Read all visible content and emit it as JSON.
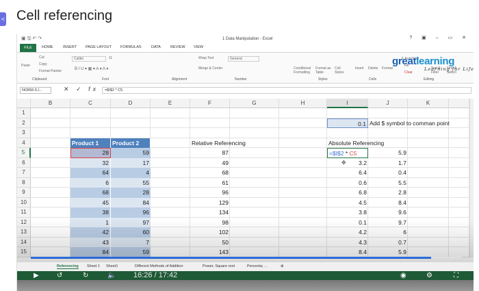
{
  "page": {
    "title": "Cell referencing",
    "side_tab": "<"
  },
  "excel": {
    "window_title": "1 Data Manipulation - Excel",
    "window_buttons": "? ▣ – ▭ ✕",
    "file_tab": "FILE",
    "tabs": [
      "HOME",
      "INSERT",
      "PAGE LAYOUT",
      "FORMULAS",
      "DATA",
      "REVIEW",
      "VIEW"
    ],
    "ribbon": {
      "clipboard": {
        "paste": "Paste",
        "cut": "Cut",
        "copy": "Copy",
        "format_painter": "Format Painter",
        "label": "Clipboard"
      },
      "font": {
        "name": "Calibri",
        "size": "11",
        "label": "Font"
      },
      "alignment": {
        "wrap": "Wrap Text",
        "merge": "Merge & Center",
        "label": "Alignment"
      },
      "number": {
        "format": "General",
        "label": "Number"
      },
      "styles": {
        "conditional": "Conditional Formatting",
        "format_table": "Format as Table",
        "cell_styles": "Cell Styles",
        "label": "Styles"
      },
      "cells": {
        "insert": "Insert",
        "delete": "Delete",
        "format": "Format",
        "label": "Cells"
      },
      "editing": {
        "autosum": "AutoSum",
        "fill": "Fill",
        "clear": "Clear",
        "sort": "Sort & Filter",
        "find": "Find & Select",
        "label": "Editing"
      }
    },
    "logo": {
      "part1": "great",
      "part2": "learning",
      "tagline": "Learning for Life"
    },
    "name_box": "NORM.S.I...",
    "formula": "=$I$2 * C5",
    "columns": [
      "B",
      "C",
      "D",
      "E",
      "F",
      "G",
      "H",
      "I",
      "J",
      "K"
    ],
    "rows": [
      "1",
      "2",
      "3",
      "4",
      "5",
      "6",
      "7",
      "8",
      "9",
      "10",
      "11",
      "12",
      "13",
      "14",
      "15"
    ],
    "cells": {
      "I2": "0.1",
      "J2": "Add $ symbol to comman point",
      "C4": "Product 1",
      "D4": "Product 2",
      "F4": "Relative Referencing",
      "I4": "Absolute Referencing",
      "I5_formula_part1": "=$I$2",
      "I5_formula_part2": " * ",
      "I5_formula_part3": "C5"
    },
    "product1": [
      28,
      32,
      64,
      6,
      68,
      45,
      38,
      1,
      42,
      43,
      84
    ],
    "product2": [
      59,
      17,
      4,
      55,
      28,
      84,
      96,
      97,
      60,
      7,
      59
    ],
    "relative": [
      87,
      49,
      68,
      61,
      96,
      129,
      134,
      98,
      102,
      50,
      143
    ],
    "absolute_I": [
      "",
      3.2,
      6.4,
      0.6,
      6.8,
      4.5,
      3.8,
      0.1,
      4.2,
      4.3,
      8.4
    ],
    "absolute_J": [
      5.9,
      1.7,
      0.4,
      5.5,
      2.8,
      8.4,
      9.6,
      9.7,
      6,
      0.7,
      5.9
    ],
    "sheet_tabs": [
      "Referencing",
      "Sheet 1",
      "Sheet1",
      "Different Methods of Addition",
      "Power, Square root",
      "Percenta; ..."
    ],
    "active_sheet": "Referencing"
  },
  "video": {
    "time": "16:26 / 17:42",
    "progress": 0.928,
    "replay": "10",
    "forward": "10"
  }
}
